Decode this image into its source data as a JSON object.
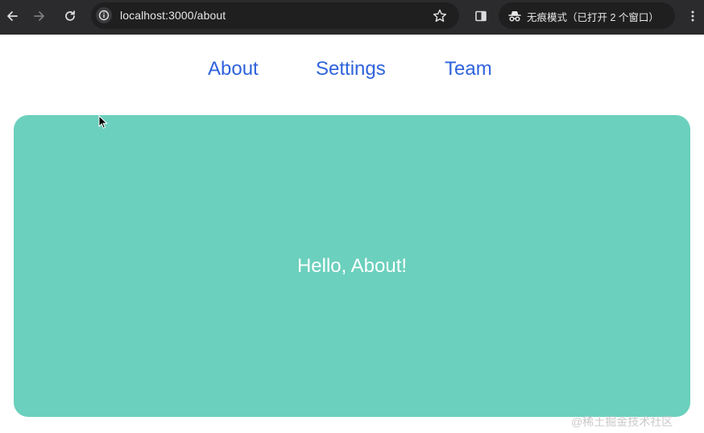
{
  "browser": {
    "url": "localhost:3000/about",
    "incognito_label": "无痕模式（已打开 2 个窗口）",
    "icons": {
      "back": "arrow-left-icon",
      "forward": "arrow-right-icon",
      "reload": "reload-icon",
      "site_info": "info-icon",
      "bookmark": "star-icon",
      "side_panel": "side-panel-icon",
      "incognito": "incognito-icon",
      "menu": "more-vert-icon"
    }
  },
  "nav": {
    "items": [
      {
        "label": "About"
      },
      {
        "label": "Settings"
      },
      {
        "label": "Team"
      }
    ],
    "link_color": "#2f63dd"
  },
  "main": {
    "card_text": "Hello, About!",
    "card_color": "#6bd0bd"
  },
  "watermark": "@稀土掘金技术社区"
}
